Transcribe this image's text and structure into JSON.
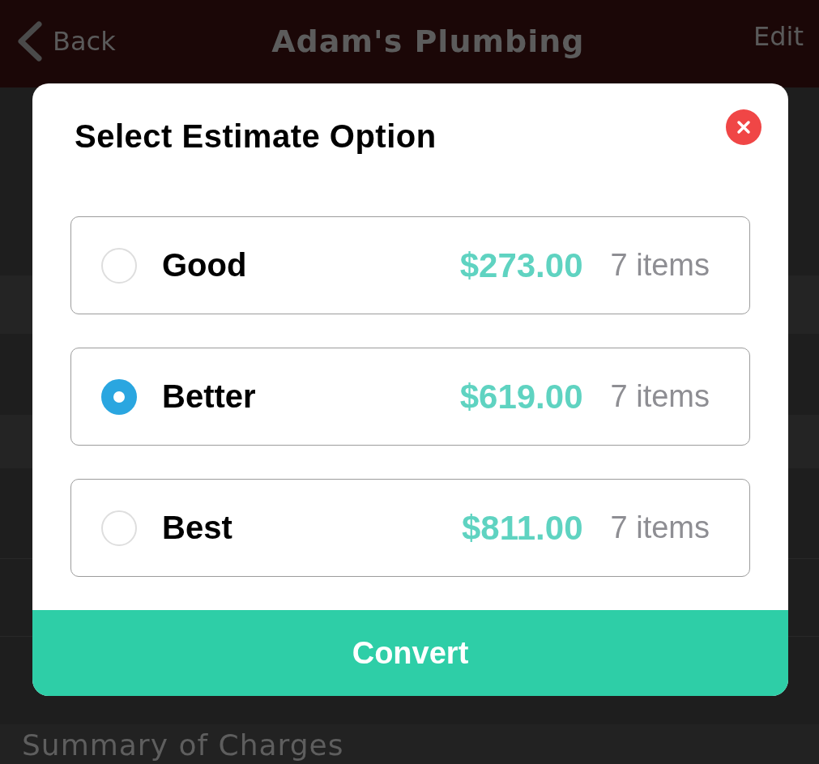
{
  "nav_bar": {
    "back_label": "Back",
    "title": "Adam's Plumbing",
    "edit_label": "Edit"
  },
  "section_header": "Summary of Charges",
  "dialog": {
    "title": "Select Estimate Option",
    "options": [
      {
        "name": "Good",
        "price": "$273.00",
        "items": "7 items",
        "selected": false
      },
      {
        "name": "Better",
        "price": "$619.00",
        "items": "7 items",
        "selected": true
      },
      {
        "name": "Best",
        "price": "$811.00",
        "items": "7 items",
        "selected": false
      }
    ],
    "convert_button": "Convert"
  }
}
